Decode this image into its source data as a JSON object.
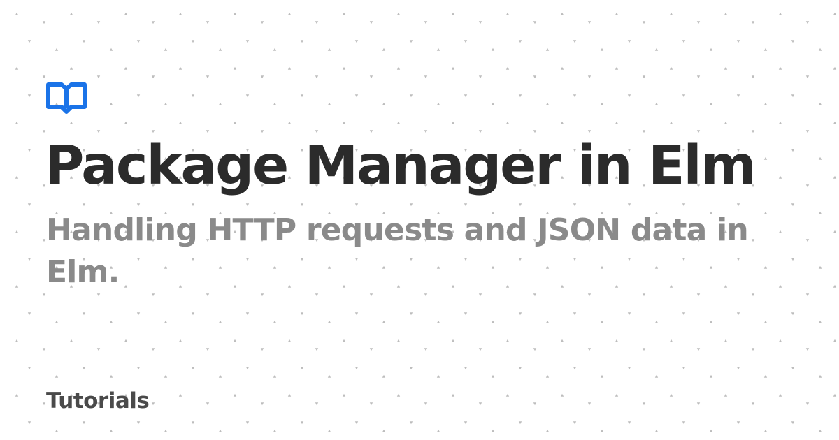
{
  "card": {
    "title": "Package Manager in Elm",
    "subtitle": "Handling HTTP requests and JSON data in Elm.",
    "category": "Tutorials",
    "logo_icon": "book-icon"
  },
  "colors": {
    "background": "#ffffff",
    "accent": "#1a73e8",
    "title": "#2b2b2b",
    "subtitle": "#8a8a8a",
    "category": "#4a4a4a",
    "pattern": "#bdbdbd"
  }
}
